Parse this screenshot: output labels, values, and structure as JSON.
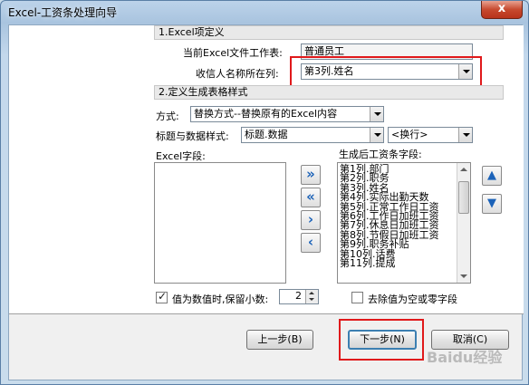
{
  "window": {
    "title": "Excel-工资条处理向导",
    "close_label": "x"
  },
  "section1": {
    "title": "1.Excel项定义",
    "current_sheet_label": "当前Excel文件工作表:",
    "current_sheet_value": "普通员工",
    "recipient_col_label": "收信人名称所在列:",
    "recipient_col_value": "第3列.姓名"
  },
  "section2": {
    "title": "2.定义生成表格样式",
    "mode_label": "方式:",
    "mode_value": "替换方式--替换原有的Excel内容",
    "style_label": "标题与数据样式:",
    "style_value": "标题.数据",
    "separator_value": "<换行>"
  },
  "excel_fields": {
    "label": "Excel字段:",
    "items": []
  },
  "generated_fields": {
    "label": "生成后工资条字段:",
    "items": [
      "第1列.部门",
      "第2列.职务",
      "第3列.姓名",
      "第4列.实际出勤天数",
      "第5列.正常工作日工资",
      "第6列.工作日加班工资",
      "第7列.休息日加班工资",
      "第8列.节假日加班工资",
      "第9列.职务补贴",
      "第10列.话费",
      "第11列.提成"
    ]
  },
  "move_buttons": {
    "add_all": "»",
    "remove_all": "«",
    "add": "›",
    "remove": "‹"
  },
  "options": {
    "decimal_label": "值为数值时,保留小数:",
    "decimal_value": "2",
    "remove_empty_label": "去除值为空或零字段"
  },
  "buttons": {
    "prev": "上一步(B)",
    "next": "下一步(N)",
    "cancel": "取消(C)"
  },
  "watermark": "Baidu经验",
  "colors": {
    "highlight": "#e0191b",
    "accent": "#1b62b8"
  }
}
